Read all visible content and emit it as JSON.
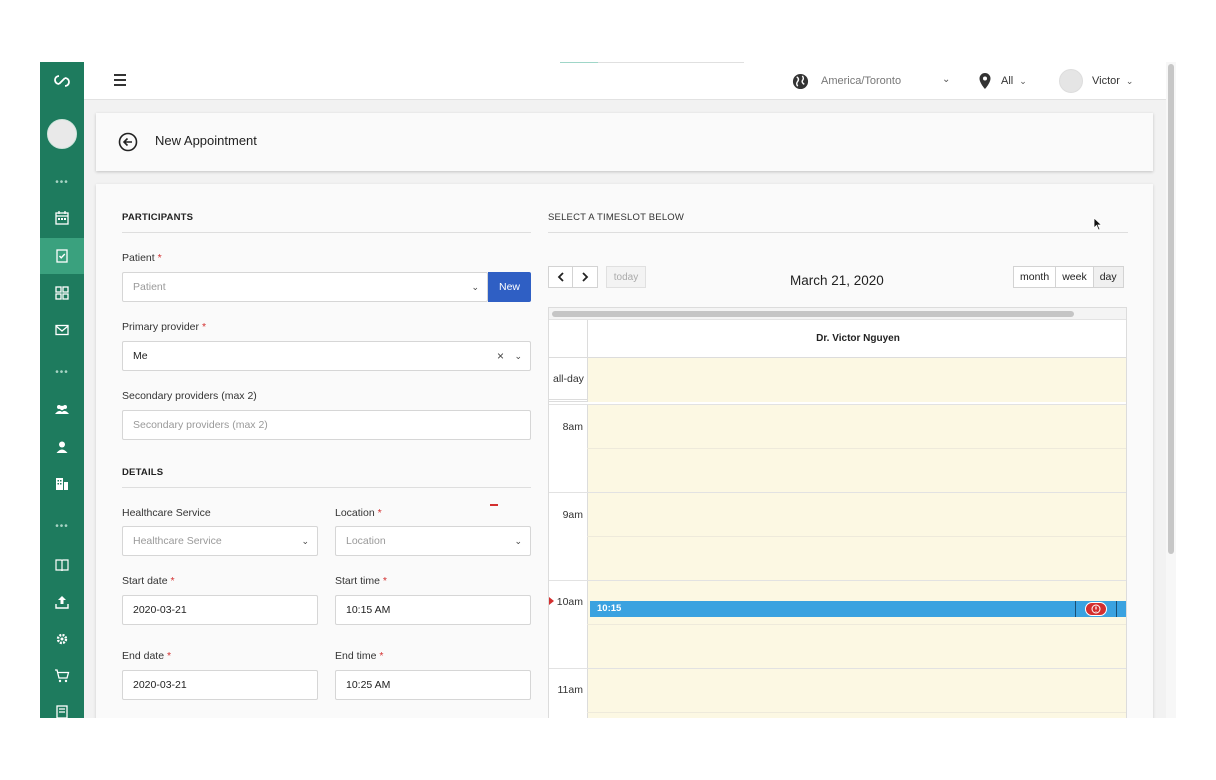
{
  "topbar": {
    "timezone": "America/Toronto",
    "location_filter": "All",
    "user_name": "Victor"
  },
  "header": {
    "title": "New Appointment"
  },
  "participants": {
    "section_title": "PARTICIPANTS",
    "patient_label": "Patient",
    "patient_placeholder": "Patient",
    "new_button": "New",
    "primary_provider_label": "Primary provider",
    "primary_provider_value": "Me",
    "secondary_label": "Secondary providers (max 2)",
    "secondary_placeholder": "Secondary providers (max 2)",
    "required_mark": "*"
  },
  "details": {
    "section_title": "DETAILS",
    "service_label": "Healthcare Service",
    "service_placeholder": "Healthcare Service",
    "location_label": "Location",
    "location_placeholder": "Location",
    "start_date_label": "Start date",
    "start_date_value": "2020-03-21",
    "start_time_label": "Start time",
    "start_time_value": "10:15 AM",
    "end_date_label": "End date",
    "end_date_value": "2020-03-21",
    "end_time_label": "End time",
    "end_time_value": "10:25 AM"
  },
  "calendar": {
    "section_title": "SELECT A TIMESLOT BELOW",
    "today_label": "today",
    "date_title": "March 21, 2020",
    "views": [
      "month",
      "week",
      "day"
    ],
    "active_view": "day",
    "resource": "Dr. Victor Nguyen",
    "allday_label": "all-day",
    "hours": [
      "8am",
      "9am",
      "10am",
      "11am"
    ],
    "event_time": "10:15",
    "event_color": "#3aa2e0",
    "slot_color": "#fcf8e3"
  },
  "colors": {
    "sidebar": "#1e7b5e",
    "sidebar_active": "#3aa17e",
    "primary_button": "#2f5fc4",
    "required": "#d32f2f"
  },
  "sidebar": {
    "icons": [
      "logo-icon",
      "avatar",
      "calendar-icon",
      "clipboard-check-icon",
      "grid-icon",
      "mail-icon",
      "users-icon",
      "user-icon",
      "building-icon",
      "book-icon",
      "upload-icon",
      "gear-icon",
      "cart-icon",
      "billing-icon"
    ]
  }
}
